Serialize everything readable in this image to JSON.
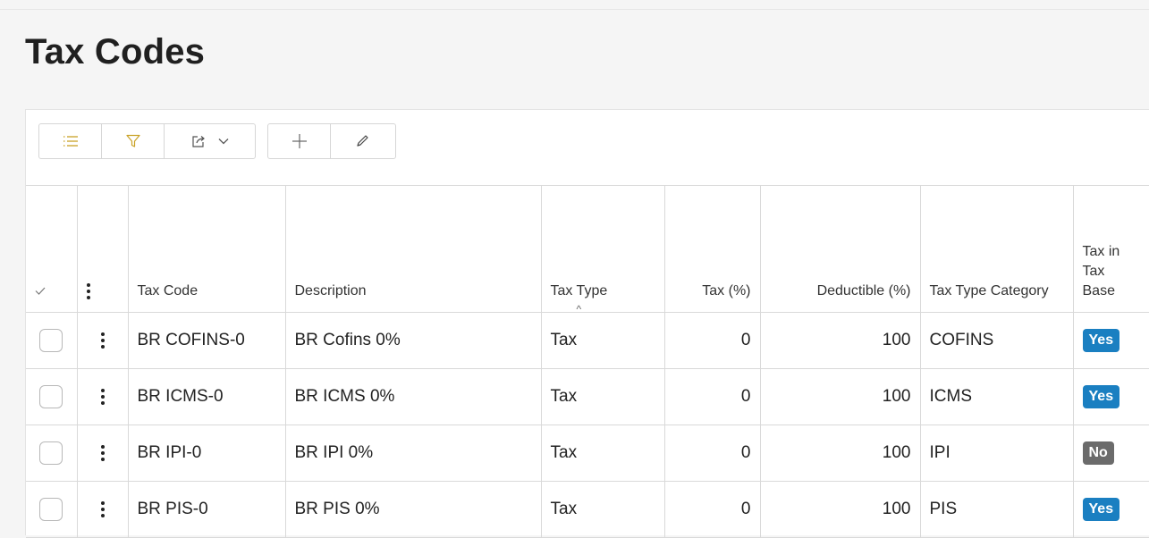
{
  "page": {
    "title": "Tax Codes"
  },
  "toolbar": {
    "buttons": [
      {
        "icon": "list-icon"
      },
      {
        "icon": "filter-icon"
      },
      {
        "icon": "export-icon"
      },
      {
        "icon": "add-icon"
      },
      {
        "icon": "edit-icon"
      }
    ]
  },
  "table": {
    "columns": {
      "tax_code": "Tax Code",
      "description": "Description",
      "tax_type": "Tax Type",
      "tax_pct": "Tax (%)",
      "deductible_pct": "Deductible (%)",
      "tax_type_category": "Tax Type Category",
      "tax_in_tax_base": "Tax in Tax Base"
    },
    "rows": [
      {
        "tax_code": "BR COFINS-0",
        "description": "BR Cofins 0%",
        "tax_type": "Tax",
        "tax_pct": "0",
        "deductible_pct": "100",
        "tax_type_category": "COFINS",
        "tax_in_tax_base": "Yes"
      },
      {
        "tax_code": "BR ICMS-0",
        "description": "BR ICMS 0%",
        "tax_type": "Tax",
        "tax_pct": "0",
        "deductible_pct": "100",
        "tax_type_category": "ICMS",
        "tax_in_tax_base": "Yes"
      },
      {
        "tax_code": "BR IPI-0",
        "description": "BR IPI 0%",
        "tax_type": "Tax",
        "tax_pct": "0",
        "deductible_pct": "100",
        "tax_type_category": "IPI",
        "tax_in_tax_base": "No"
      },
      {
        "tax_code": "BR PIS-0",
        "description": "BR PIS 0%",
        "tax_type": "Tax",
        "tax_pct": "0",
        "deductible_pct": "100",
        "tax_type_category": "PIS",
        "tax_in_tax_base": "Yes"
      }
    ]
  },
  "colors": {
    "accent_yes": "#1a7fc1",
    "badge_no": "#6b6b6b",
    "toolbar_icon": "#c9a227"
  }
}
